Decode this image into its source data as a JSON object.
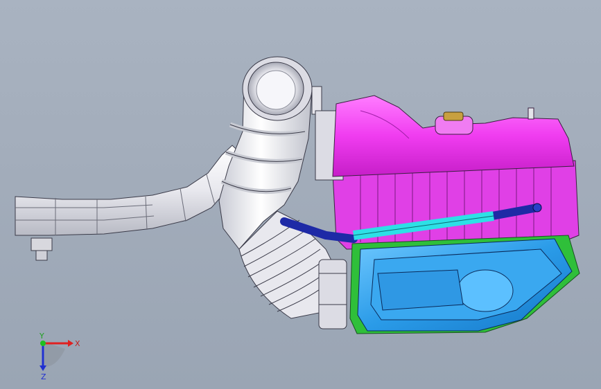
{
  "viewport": {
    "background_top": "#a9b3c1",
    "background_bottom": "#9aa5b4"
  },
  "model": {
    "parts": [
      {
        "name": "air-intake-duct",
        "color": "#f2f2f4"
      },
      {
        "name": "flex-bellows-hose",
        "color": "#efeff2"
      },
      {
        "name": "airbox-cover",
        "color": "#f03cf0"
      },
      {
        "name": "airbox-lower-housing",
        "color": "#e040e6"
      },
      {
        "name": "resonator-tray",
        "color": "#2a9be8"
      },
      {
        "name": "resonator-gasket",
        "color": "#2fbf3a"
      },
      {
        "name": "breather-tube-blue",
        "color": "#1e2aa6"
      },
      {
        "name": "breather-sleeve-cyan",
        "color": "#2de0e6"
      }
    ]
  },
  "triad": {
    "x_label": "X",
    "y_label": "Y",
    "z_label": "Z",
    "x_color": "#e02020",
    "y_color": "#20c020",
    "z_color": "#2030d0"
  }
}
